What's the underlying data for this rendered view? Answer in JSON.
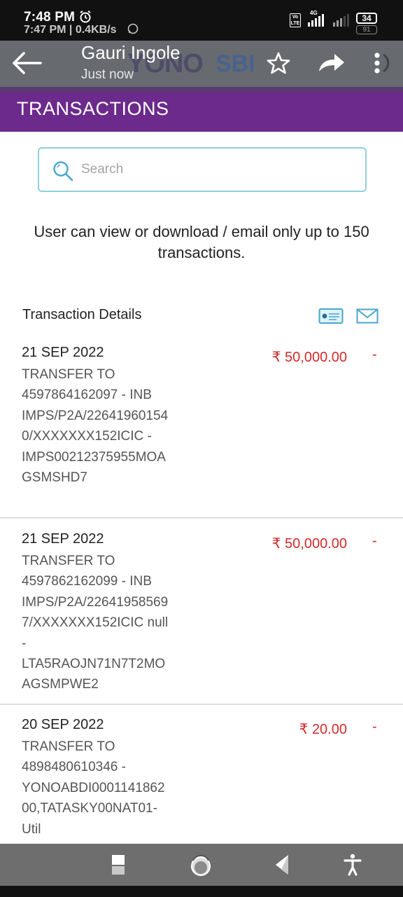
{
  "status_bar": {
    "time": "7:48 PM",
    "time_secondary": "7:47 PM | 0.4KB/s",
    "network": "4G",
    "volte": "Vo LTE",
    "battery": "34",
    "battery_secondary": "91"
  },
  "header": {
    "title": "Gauri Ingole",
    "subtitle": "Just now",
    "brand_left": "YONO",
    "brand_right": "SBI"
  },
  "page": {
    "title": "TRANSACTIONS"
  },
  "search": {
    "placeholder": "Search"
  },
  "notice": "User can view or download / email only up to 150 transactions.",
  "details_heading": "Transaction Details",
  "transactions": [
    {
      "date": "21 SEP 2022",
      "description": "TRANSFER TO 4597864162097 - INB IMPS/P2A/226419601540/XXXXXXX152ICIC - IMPS00212375955MOAGSMSHD7",
      "amount": "₹ 50,000.00",
      "type": "-"
    },
    {
      "date": "21 SEP 2022",
      "description": "TRANSFER TO 4597862162099 - INB IMPS/P2A/226419585697/XXXXXXX152ICIC null - LTA5RAOJN71N7T2MOAGSMPWE2",
      "amount": "₹ 50,000.00",
      "type": "-"
    },
    {
      "date": "20 SEP 2022",
      "description": "TRANSFER TO 4898480610346 - YONOABDI000114186200,TATASKY00NAT01-Util",
      "amount": "₹ 20.00",
      "type": "-"
    }
  ],
  "colors": {
    "purple": "#6c2a8c",
    "amount_red": "#d42a2a",
    "search_border": "#8fd0dc",
    "header_gray": "#676a6f"
  }
}
